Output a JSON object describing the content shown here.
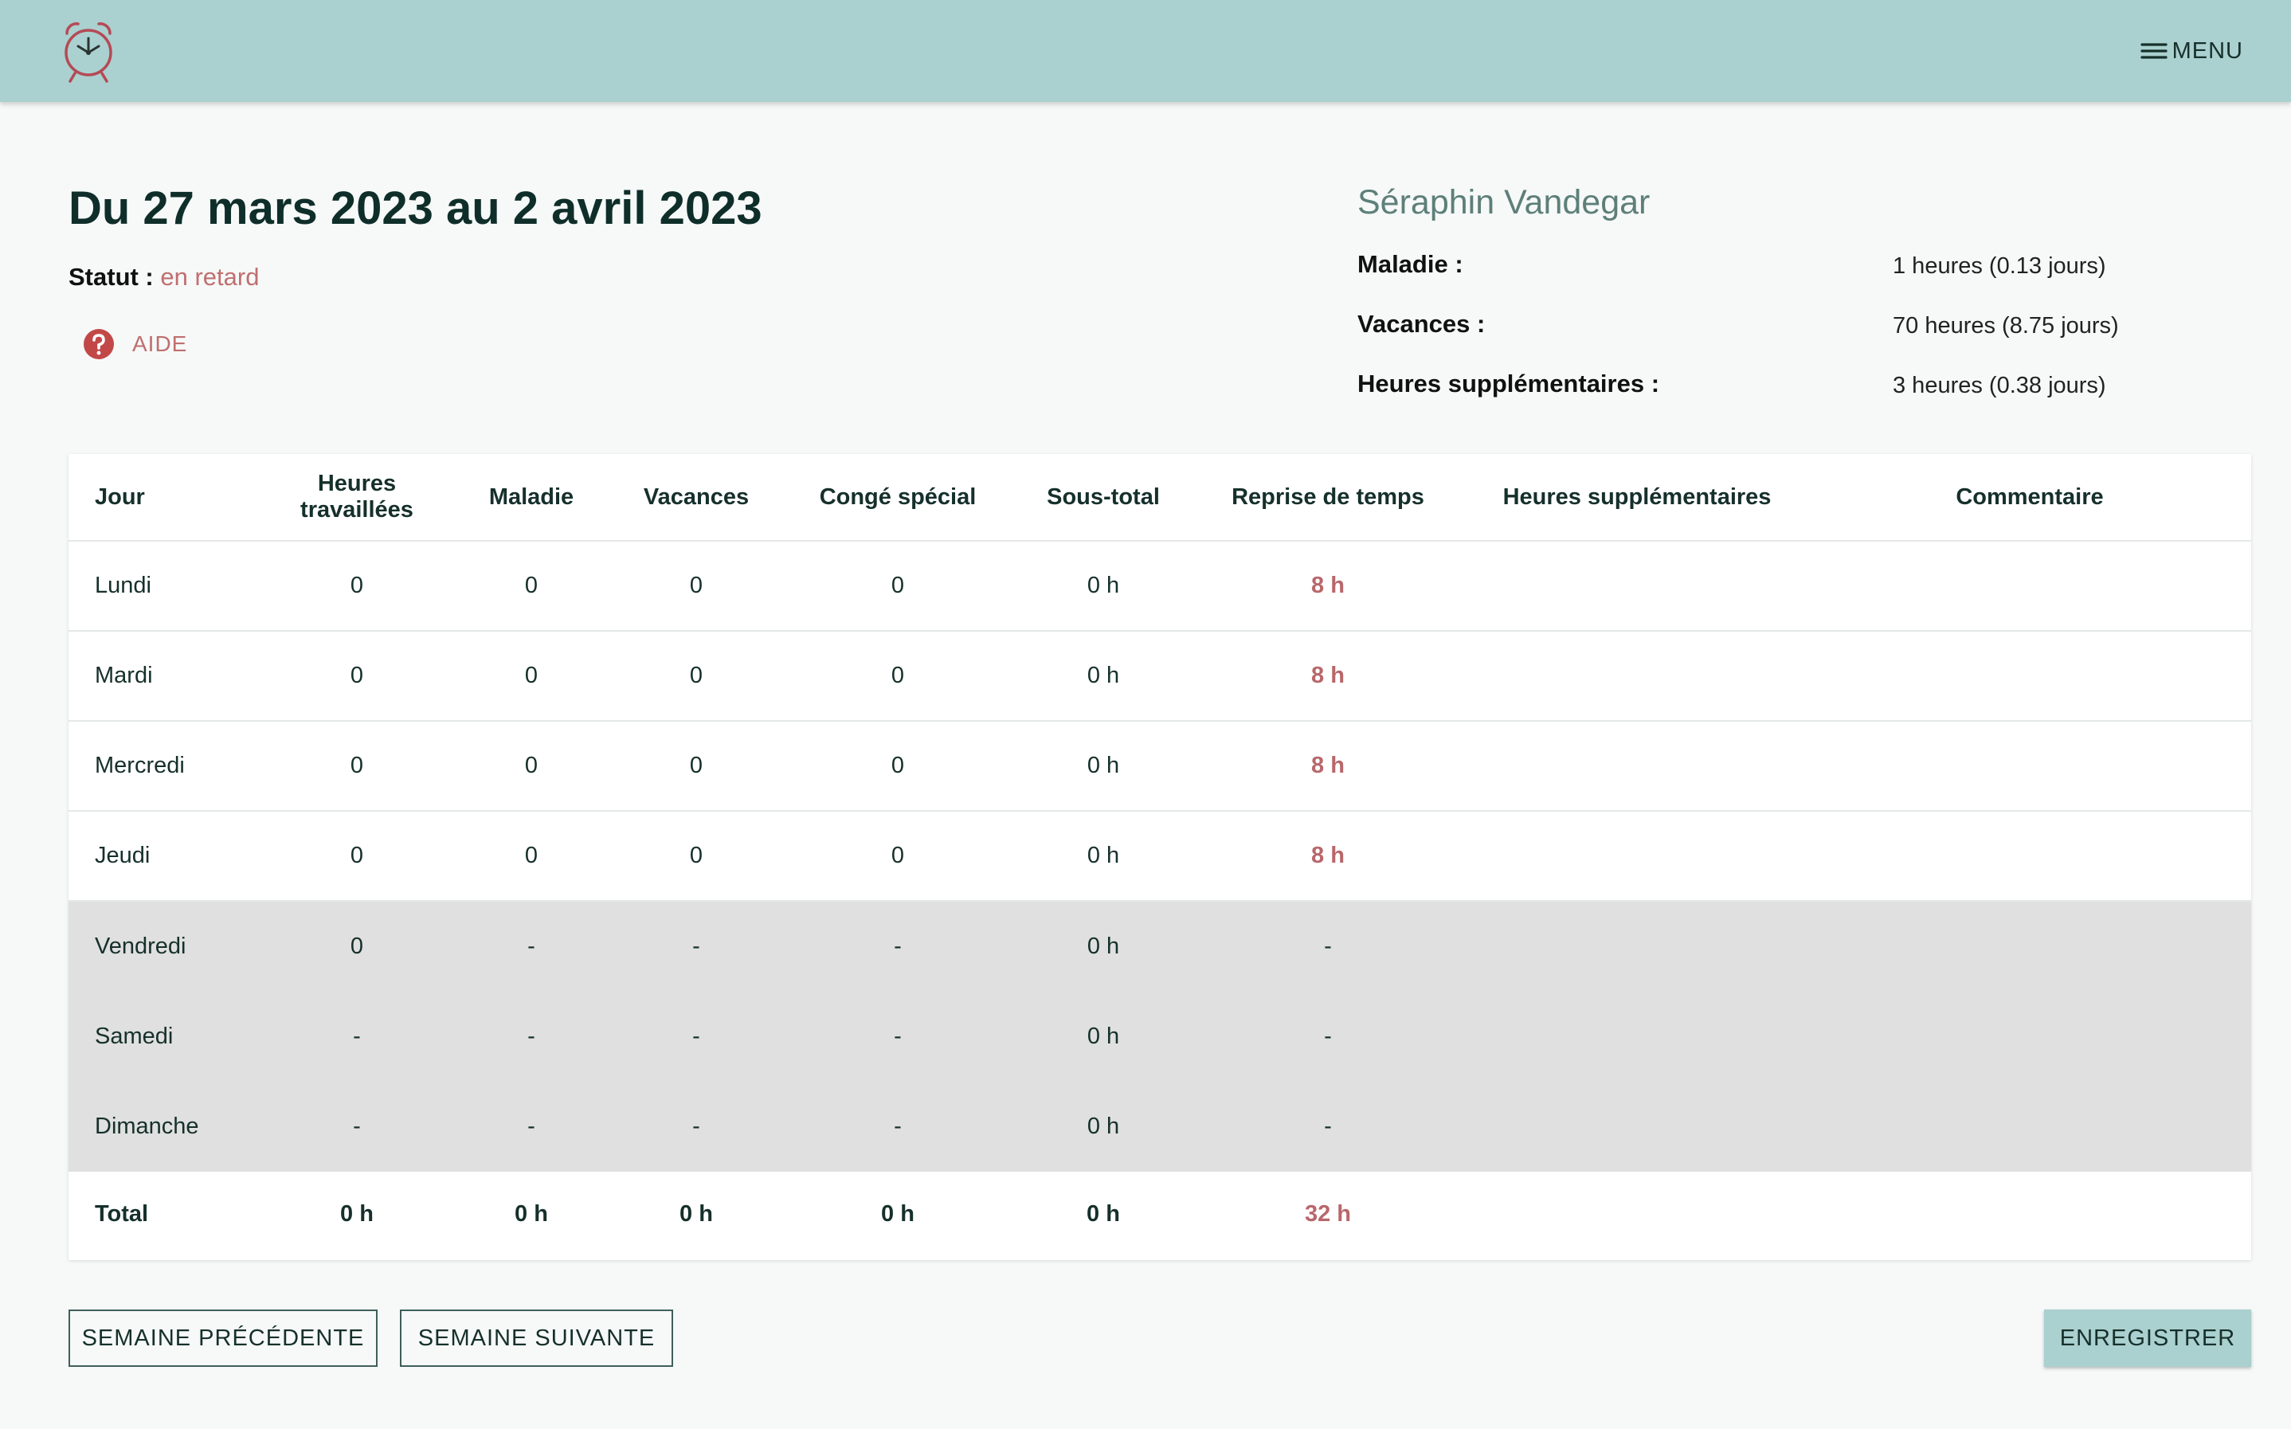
{
  "app": {
    "logo_icon": "alarm-clock-icon",
    "menu_label": "MENU",
    "menu_icon": "hamburger-icon"
  },
  "header": {
    "title": "Du 27 mars 2023 au 2 avril 2023",
    "status_label": "Statut :",
    "status_value": "en retard",
    "help_label": "AIDE",
    "help_icon": "question-circle-icon"
  },
  "employee": {
    "name": "Séraphin Vandegar",
    "balances": [
      {
        "label": "Maladie :",
        "value": "1 heures (0.13 jours)"
      },
      {
        "label": "Vacances :",
        "value": "70 heures (8.75 jours)"
      },
      {
        "label": "Heures supplémentaires :",
        "value": "3 heures (0.38 jours)"
      }
    ]
  },
  "table": {
    "columns": [
      "Jour",
      "Heures travaillées",
      "Maladie",
      "Vacances",
      "Congé spécial",
      "Sous-total",
      "Reprise de temps",
      "Heures supplémentaires",
      "Commentaire"
    ],
    "rows": [
      {
        "day": "Lundi",
        "worked": "0",
        "sick": "0",
        "vacation": "0",
        "special": "0",
        "subtotal": "0 h",
        "recovery": "8 h",
        "overtime": "",
        "comment": ""
      },
      {
        "day": "Mardi",
        "worked": "0",
        "sick": "0",
        "vacation": "0",
        "special": "0",
        "subtotal": "0 h",
        "recovery": "8 h",
        "overtime": "",
        "comment": ""
      },
      {
        "day": "Mercredi",
        "worked": "0",
        "sick": "0",
        "vacation": "0",
        "special": "0",
        "subtotal": "0 h",
        "recovery": "8 h",
        "overtime": "",
        "comment": ""
      },
      {
        "day": "Jeudi",
        "worked": "0",
        "sick": "0",
        "vacation": "0",
        "special": "0",
        "subtotal": "0 h",
        "recovery": "8 h",
        "overtime": "",
        "comment": ""
      },
      {
        "day": "Vendredi",
        "worked": "0",
        "sick": "-",
        "vacation": "-",
        "special": "-",
        "subtotal": "0 h",
        "recovery": "-",
        "overtime": "",
        "comment": ""
      },
      {
        "day": "Samedi",
        "worked": "-",
        "sick": "-",
        "vacation": "-",
        "special": "-",
        "subtotal": "0 h",
        "recovery": "-",
        "overtime": "",
        "comment": ""
      },
      {
        "day": "Dimanche",
        "worked": "-",
        "sick": "-",
        "vacation": "-",
        "special": "-",
        "subtotal": "0 h",
        "recovery": "-",
        "overtime": "",
        "comment": ""
      }
    ],
    "total": {
      "day": "Total",
      "worked": "0 h",
      "sick": "0 h",
      "vacation": "0 h",
      "special": "0 h",
      "subtotal": "0 h",
      "recovery": "32 h",
      "overtime": "",
      "comment": ""
    }
  },
  "footer": {
    "prev_label": "SEMAINE PRÉCÉDENTE",
    "next_label": "SEMAINE SUIVANTE",
    "save_label": "ENREGISTRER"
  },
  "colors": {
    "topbar": "#aad0cf",
    "accent_red": "#b8676b",
    "weekend_row": "#dfe0df",
    "title": "#0f2e2a"
  }
}
